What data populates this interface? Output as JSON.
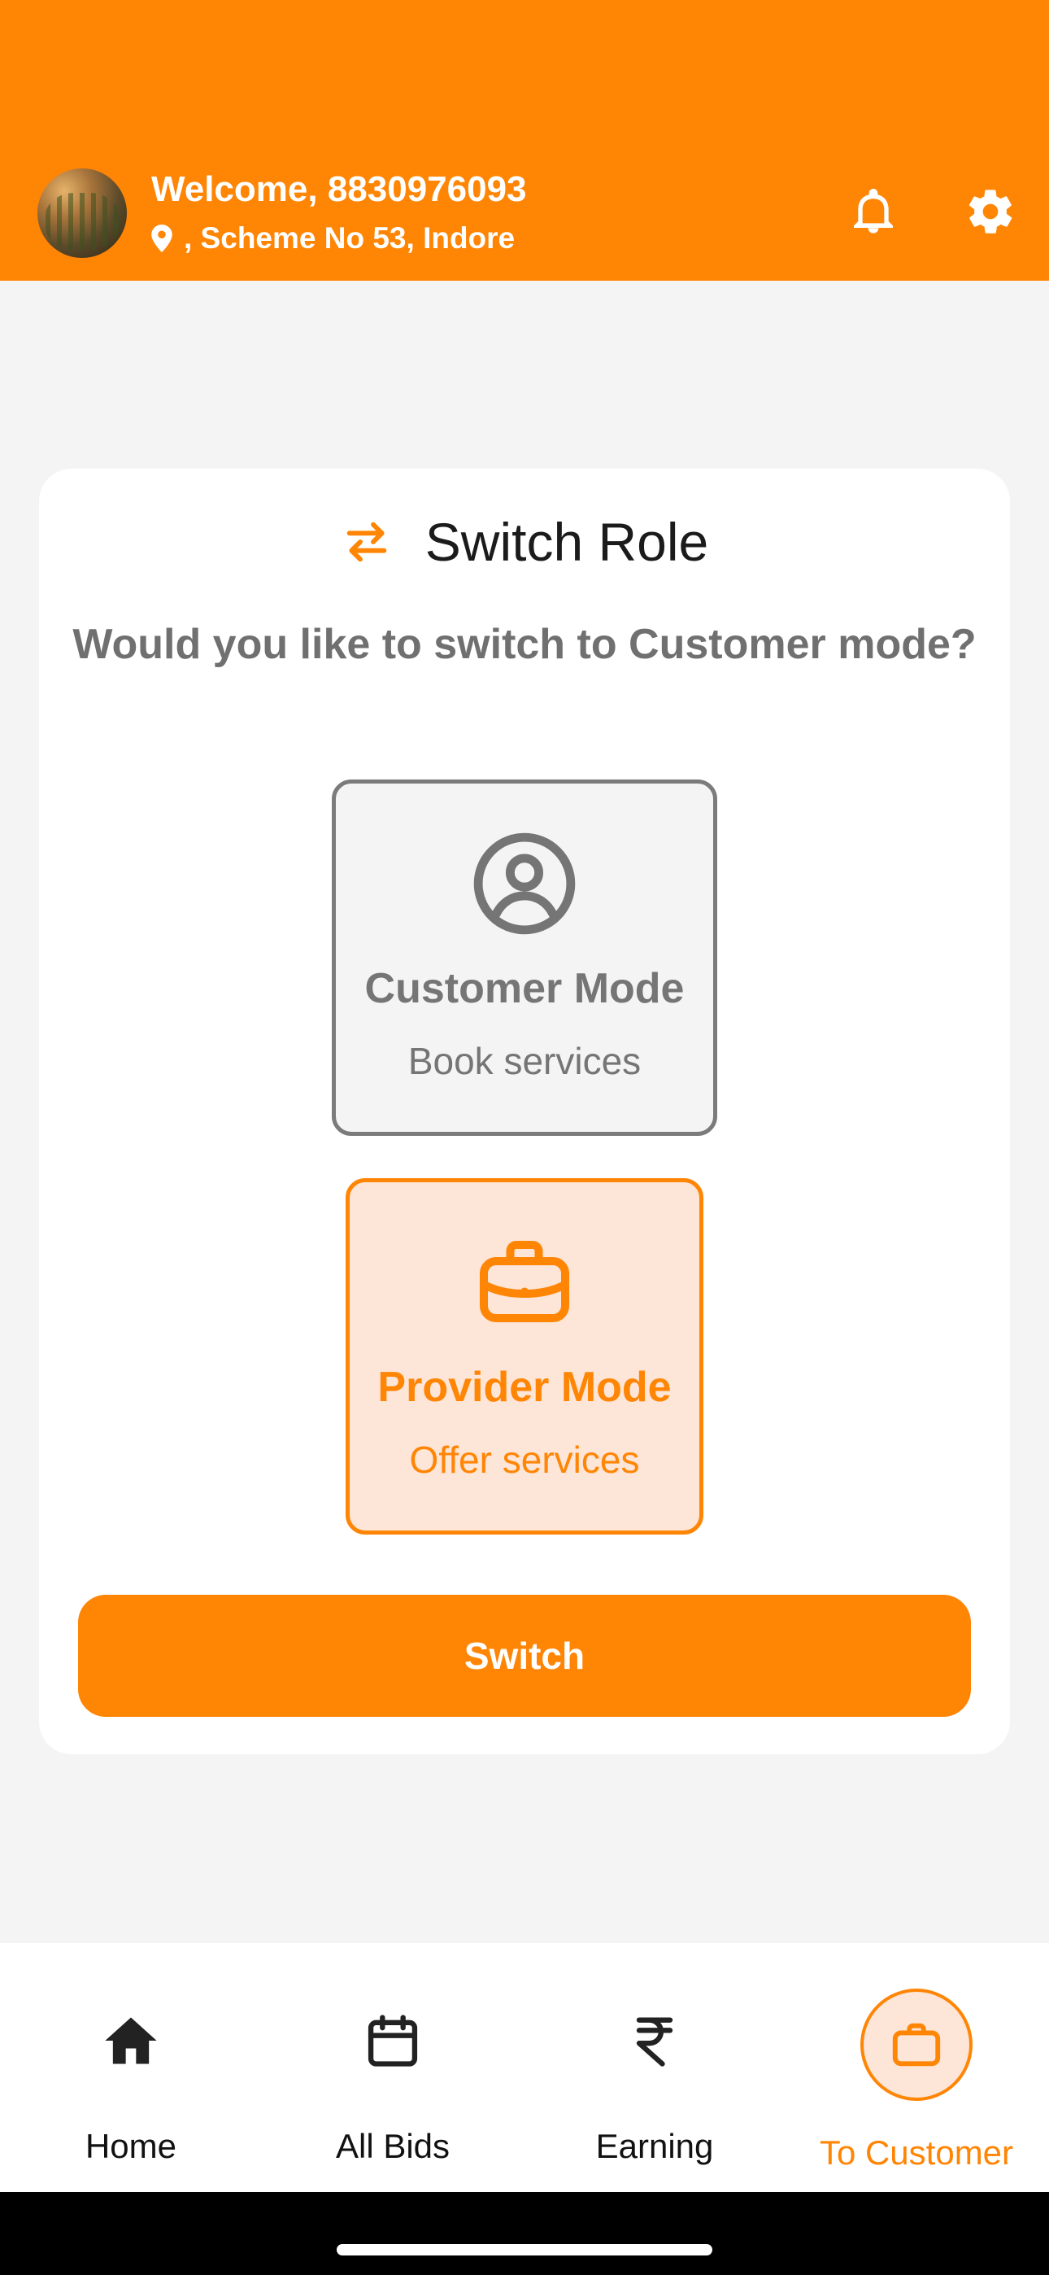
{
  "header": {
    "welcome": "Welcome, 8830976093",
    "location": ", Scheme No 53, Indore",
    "icons": [
      "notification-bell-icon",
      "settings-gear-icon"
    ],
    "color": "#FF8505"
  },
  "card": {
    "title": "Switch Role",
    "question": "Would you like to switch to Customer mode?",
    "customer_mode": {
      "title": "Customer Mode",
      "subtitle": "Book services",
      "icon": "user-circle-icon"
    },
    "provider_mode": {
      "title": "Provider Mode",
      "subtitle": "Offer services",
      "icon": "briefcase-icon",
      "selected": true
    },
    "switch_button": "Switch"
  },
  "bottom_nav": {
    "items": [
      {
        "label": "Home",
        "icon": "home-icon"
      },
      {
        "label": "All Bids",
        "icon": "calendar-icon"
      },
      {
        "label": "Earning",
        "icon": "rupee-icon"
      },
      {
        "label": "To Customer",
        "icon": "briefcase-icon",
        "active": true
      }
    ]
  },
  "colors": {
    "accent": "#FF8505",
    "accent_light": "#FDE5D7",
    "background": "#F4F4F4"
  }
}
